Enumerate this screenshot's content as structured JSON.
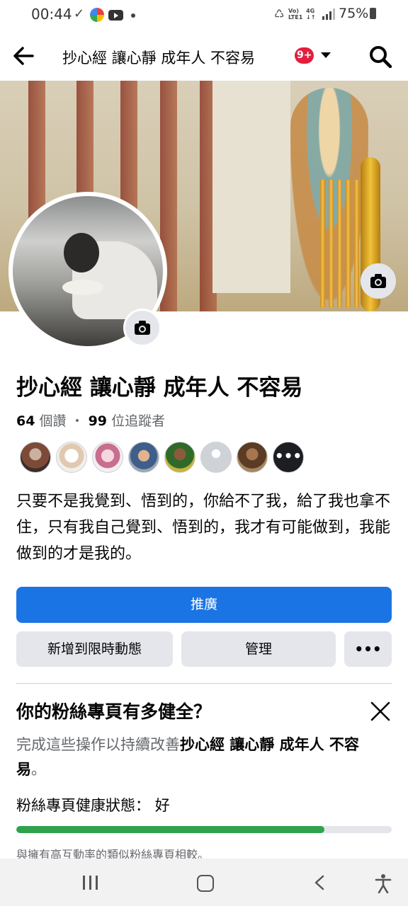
{
  "status_bar": {
    "time": "00:44",
    "check": "✓",
    "net_top": "Vo)",
    "net_bottom": "LTE1",
    "net2_top": "4G",
    "net2_bottom": "↓↑",
    "battery": "75%"
  },
  "header": {
    "title": "抄心經 讓心靜 成年人 不容易",
    "badge": "9+"
  },
  "profile": {
    "name": "抄心經 讓心靜 成年人 不容易",
    "likes_count": "64",
    "likes_label": " 個讚 ・ ",
    "followers_count": "99",
    "followers_prefix": " 位",
    "followers_label": "追蹤者",
    "more_friends": "•••",
    "bio": "只要不是我覺到、悟到的，你給不了我，給了我也拿不住，只有我自己覺到、悟到的，我才有可能做到，我能做到的才是我的。"
  },
  "actions": {
    "promote": "推廣",
    "add_to_story": "新增到限時動態",
    "manage": "管理",
    "more": "•••"
  },
  "health": {
    "title": "你的粉絲專頁有多健全？",
    "desc_prefix": "完成這些操作以持續改善",
    "desc_page": "抄心經 讓心靜 成年人 不容易",
    "desc_suffix": "。",
    "status_label": "粉絲專頁健康狀態：",
    "status_value": "好",
    "progress": 0.82,
    "compare": "與擁有高互動率的類似粉絲專頁相較。"
  },
  "colors": {
    "primary": "#1b74e4",
    "badge": "#e41e3f",
    "progress": "#31a24c"
  },
  "icons": {
    "back": "arrow-left",
    "search": "magnifier",
    "camera": "camera",
    "close": "x"
  }
}
